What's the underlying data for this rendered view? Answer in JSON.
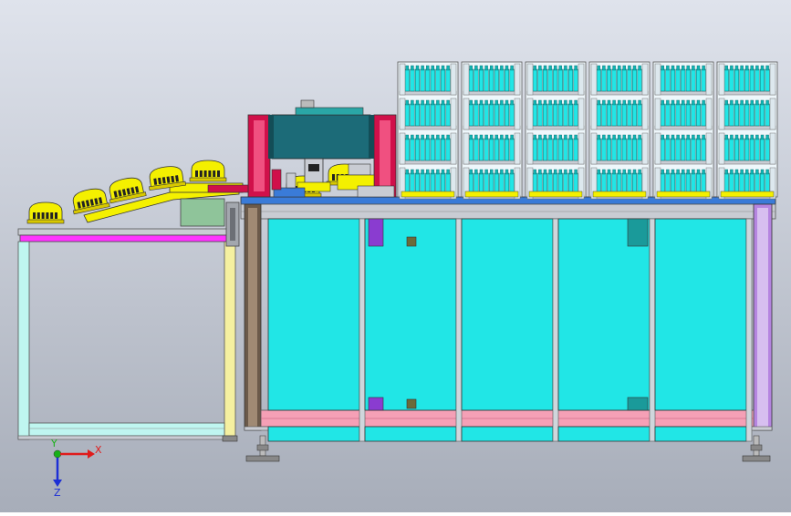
{
  "viewport": {
    "background_top": "#dfe3ec",
    "background_bottom": "#a7adb9"
  },
  "axes_triad": {
    "x_label": "X",
    "y_label": "Y",
    "z_label": "Z",
    "x_color": "#e01b1b",
    "y_color": "#18b018",
    "z_color": "#1c2fd6"
  },
  "colors": {
    "cyan": "#21e6e6",
    "cyan_dark": "#0fb4b4",
    "teal_block": "#1c6b78",
    "yellow": "#f4f000",
    "magenta": "#ff33ff",
    "pink": "#f5a0b6",
    "crimson": "#d0104a",
    "rail_blue": "#3a7bd8",
    "frame_grey": "#c9ccd3",
    "frame_dark": "#6c6f76",
    "olive_box": "#8fc49a",
    "purple": "#8a3cd0",
    "dark_brown": "#6b5a4a",
    "light_cyan_frame": "#bff6f0"
  },
  "structure": {
    "tray_stacks": 6,
    "tray_levels": 4,
    "lower_panels": 5,
    "yellow_fixtures": 7
  }
}
